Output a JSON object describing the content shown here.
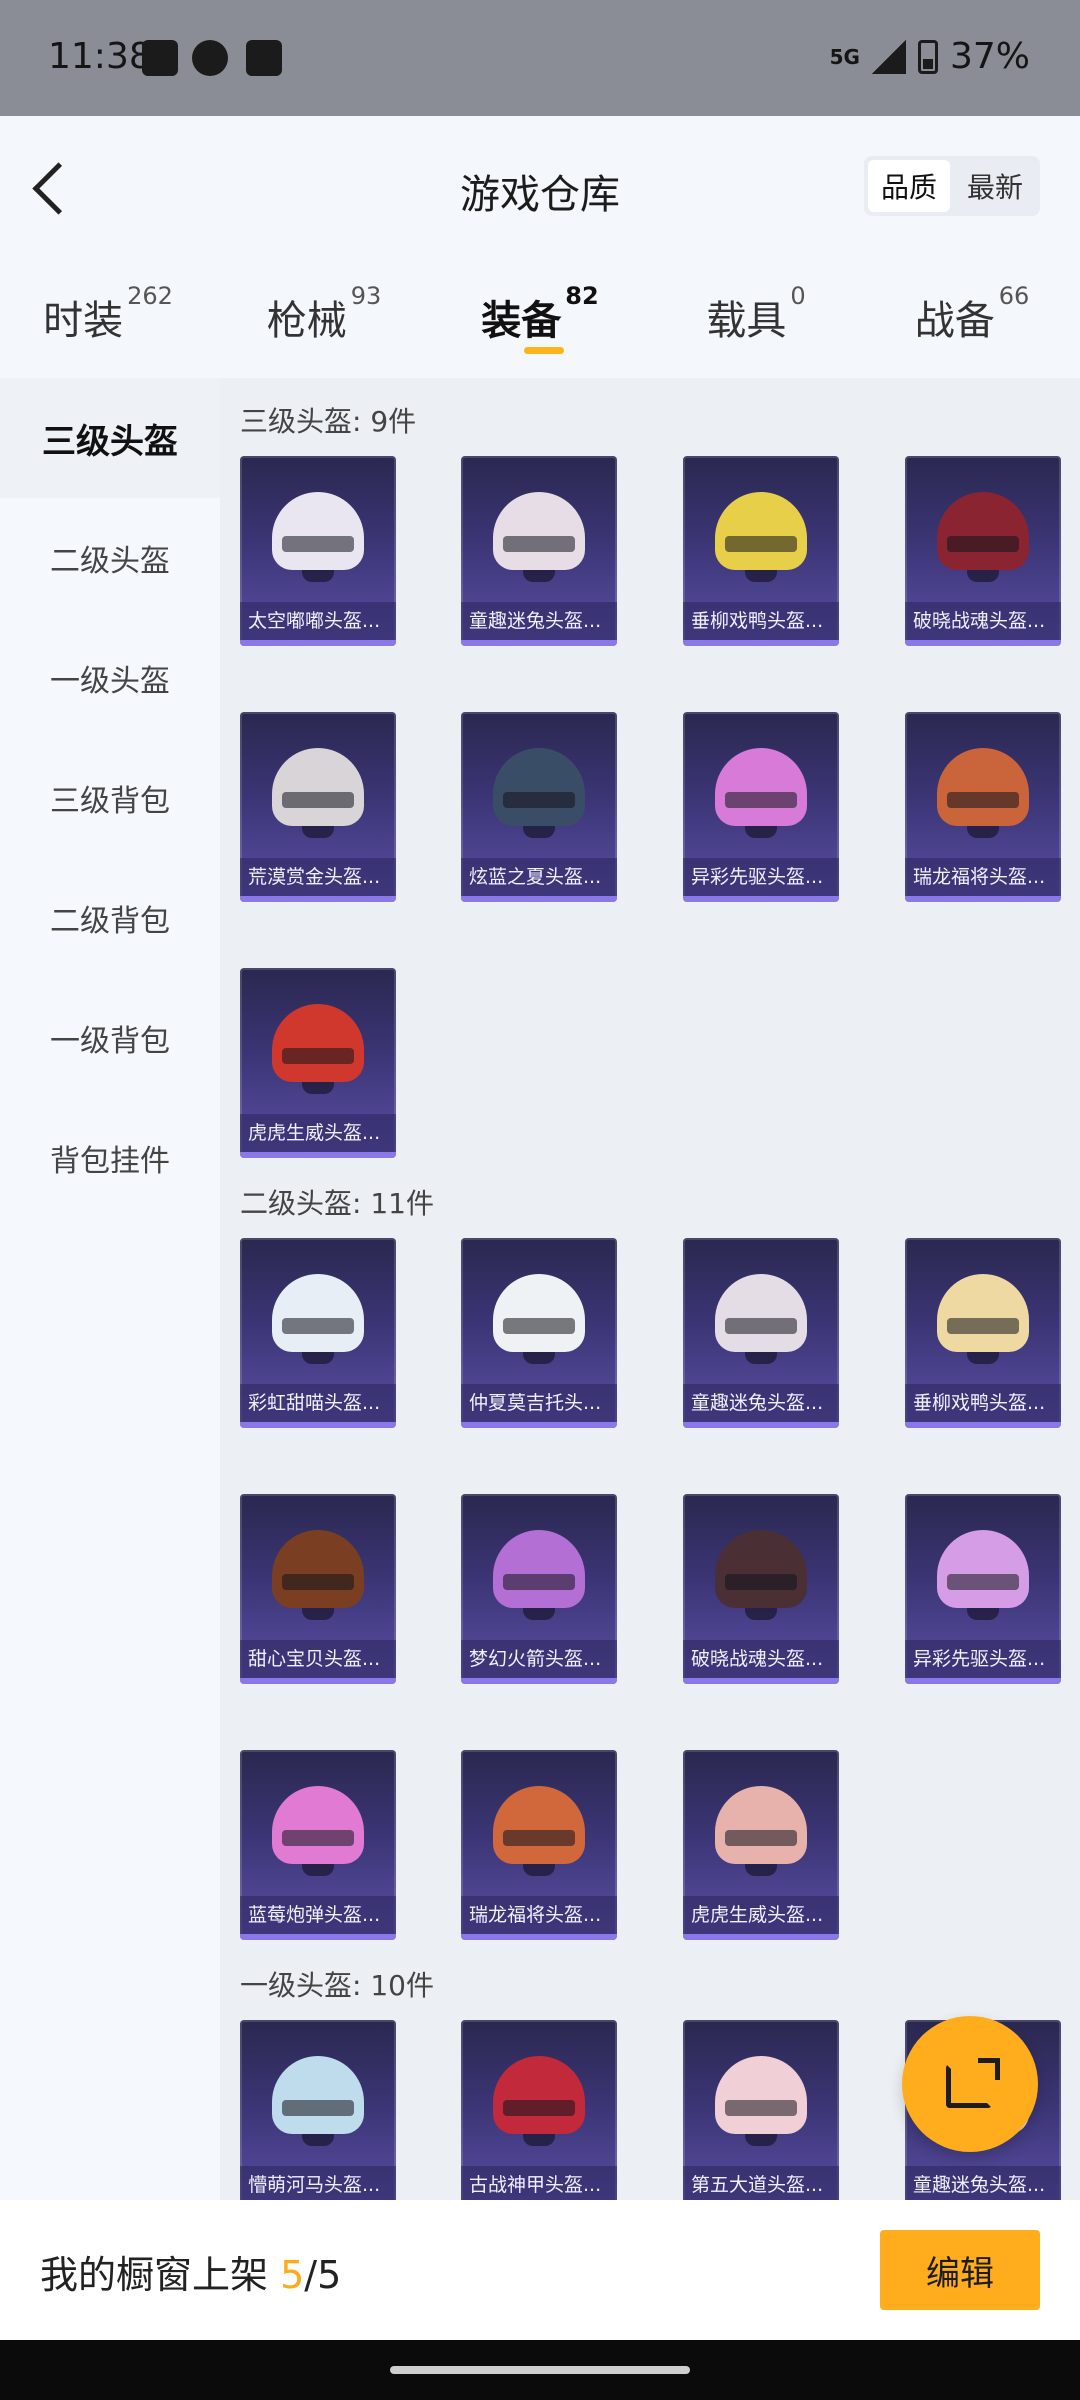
{
  "status_bar": {
    "time": "11:38",
    "network": "5G",
    "battery": "37%"
  },
  "header": {
    "title": "游戏仓库",
    "sort": [
      "品质",
      "最新"
    ]
  },
  "tabs": [
    {
      "label": "时装",
      "count": "262"
    },
    {
      "label": "枪械",
      "count": "93"
    },
    {
      "label": "装备",
      "count": "82"
    },
    {
      "label": "载具",
      "count": "0"
    },
    {
      "label": "战备",
      "count": "66"
    }
  ],
  "sidebar": [
    "三级头盔",
    "二级头盔",
    "一级头盔",
    "三级背包",
    "二级背包",
    "一级背包",
    "背包挂件"
  ],
  "sections": [
    {
      "title": "三级头盔: 9件",
      "items": [
        {
          "name": "太空嘟嘟头盔...",
          "color": "#e9e6f2"
        },
        {
          "name": "童趣迷兔头盔...",
          "color": "#e6dde6"
        },
        {
          "name": "垂柳戏鸭头盔...",
          "color": "#e8cf4a"
        },
        {
          "name": "破晓战魂头盔...",
          "color": "#8a2430"
        },
        {
          "name": "荒漠赏金头盔...",
          "color": "#d8d4d8"
        },
        {
          "name": "炫蓝之夏头盔...",
          "color": "#3a4d66"
        },
        {
          "name": "异彩先驱头盔...",
          "color": "#d77ad8"
        },
        {
          "name": "瑞龙福将头盔...",
          "color": "#c9643b"
        },
        {
          "name": "虎虎生威头盔...",
          "color": "#d0382e"
        }
      ]
    },
    {
      "title": "二级头盔: 11件",
      "items": [
        {
          "name": "彩虹甜喵头盔...",
          "color": "#e8eef5"
        },
        {
          "name": "仲夏莫吉托头...",
          "color": "#eef2f4"
        },
        {
          "name": "童趣迷兔头盔...",
          "color": "#e5dde6"
        },
        {
          "name": "垂柳戏鸭头盔...",
          "color": "#eed9a2"
        },
        {
          "name": "甜心宝贝头盔...",
          "color": "#7a3f22"
        },
        {
          "name": "梦幻火箭头盔...",
          "color": "#b36fd4"
        },
        {
          "name": "破晓战魂头盔...",
          "color": "#4a2f35"
        },
        {
          "name": "异彩先驱头盔...",
          "color": "#d59de6"
        },
        {
          "name": "蓝莓炮弹头盔...",
          "color": "#e07ad2"
        },
        {
          "name": "瑞龙福将头盔...",
          "color": "#d0683c"
        },
        {
          "name": "虎虎生威头盔...",
          "color": "#e6b2ab"
        }
      ]
    },
    {
      "title": "一级头盔: 10件",
      "items": [
        {
          "name": "懵萌河马头盔...",
          "color": "#bfdcec"
        },
        {
          "name": "古战神甲头盔...",
          "color": "#c2293a"
        },
        {
          "name": "第五大道头盔...",
          "color": "#f1cfd6"
        },
        {
          "name": "童趣迷兔头盔...",
          "color": "#e6dde6"
        }
      ]
    }
  ],
  "bottom_bar": {
    "label": "我的橱窗上架",
    "current": "5",
    "total": "/5",
    "edit": "编辑"
  }
}
